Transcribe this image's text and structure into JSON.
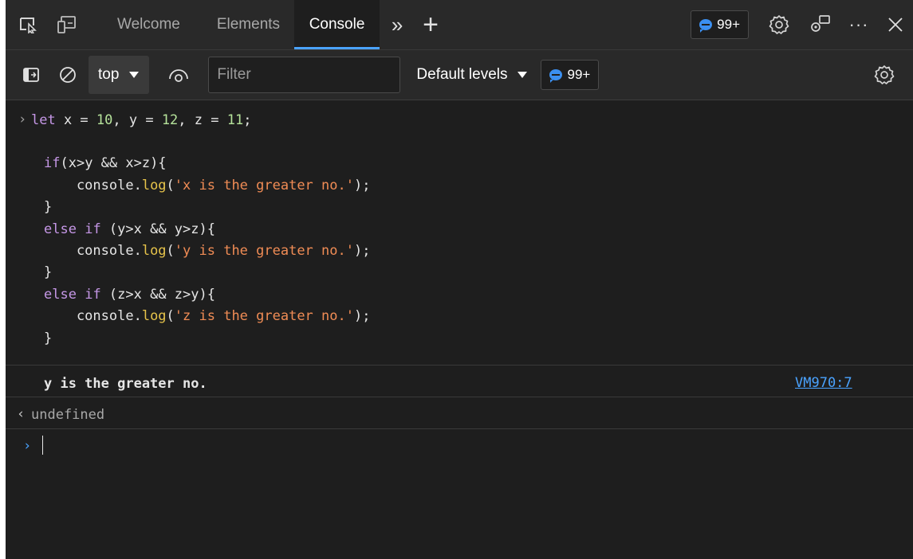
{
  "tabs": [
    {
      "label": "Welcome",
      "active": false
    },
    {
      "label": "Elements",
      "active": false
    },
    {
      "label": "Console",
      "active": true
    }
  ],
  "header": {
    "issues_badge": "99+",
    "overflow_glyph": "»",
    "add_glyph": "+",
    "more_glyph": "···"
  },
  "toolbar": {
    "context": "top",
    "filter_placeholder": "Filter",
    "levels": "Default levels",
    "issues_count": "99+"
  },
  "console": {
    "input_lines": [
      "let x = 10, y = 12, z = 11;",
      "",
      "if(x>y && x>z){",
      "    console.log('x is the greater no.');",
      "}",
      "else if (y>x && y>z){",
      "    console.log('y is the greater no.');",
      "}",
      "else if (z>x && z>y){",
      "    console.log('z is the greater no.');",
      "}"
    ],
    "log_output": "y is the greater no.",
    "log_source": "VM970:7",
    "return_value": "undefined"
  },
  "colors": {
    "keyword": "#c597e6",
    "number": "#b6e39b",
    "string": "#f08c55",
    "function": "#e6c34a",
    "link": "#4aa3ff",
    "accent": "#3b8ff0"
  }
}
